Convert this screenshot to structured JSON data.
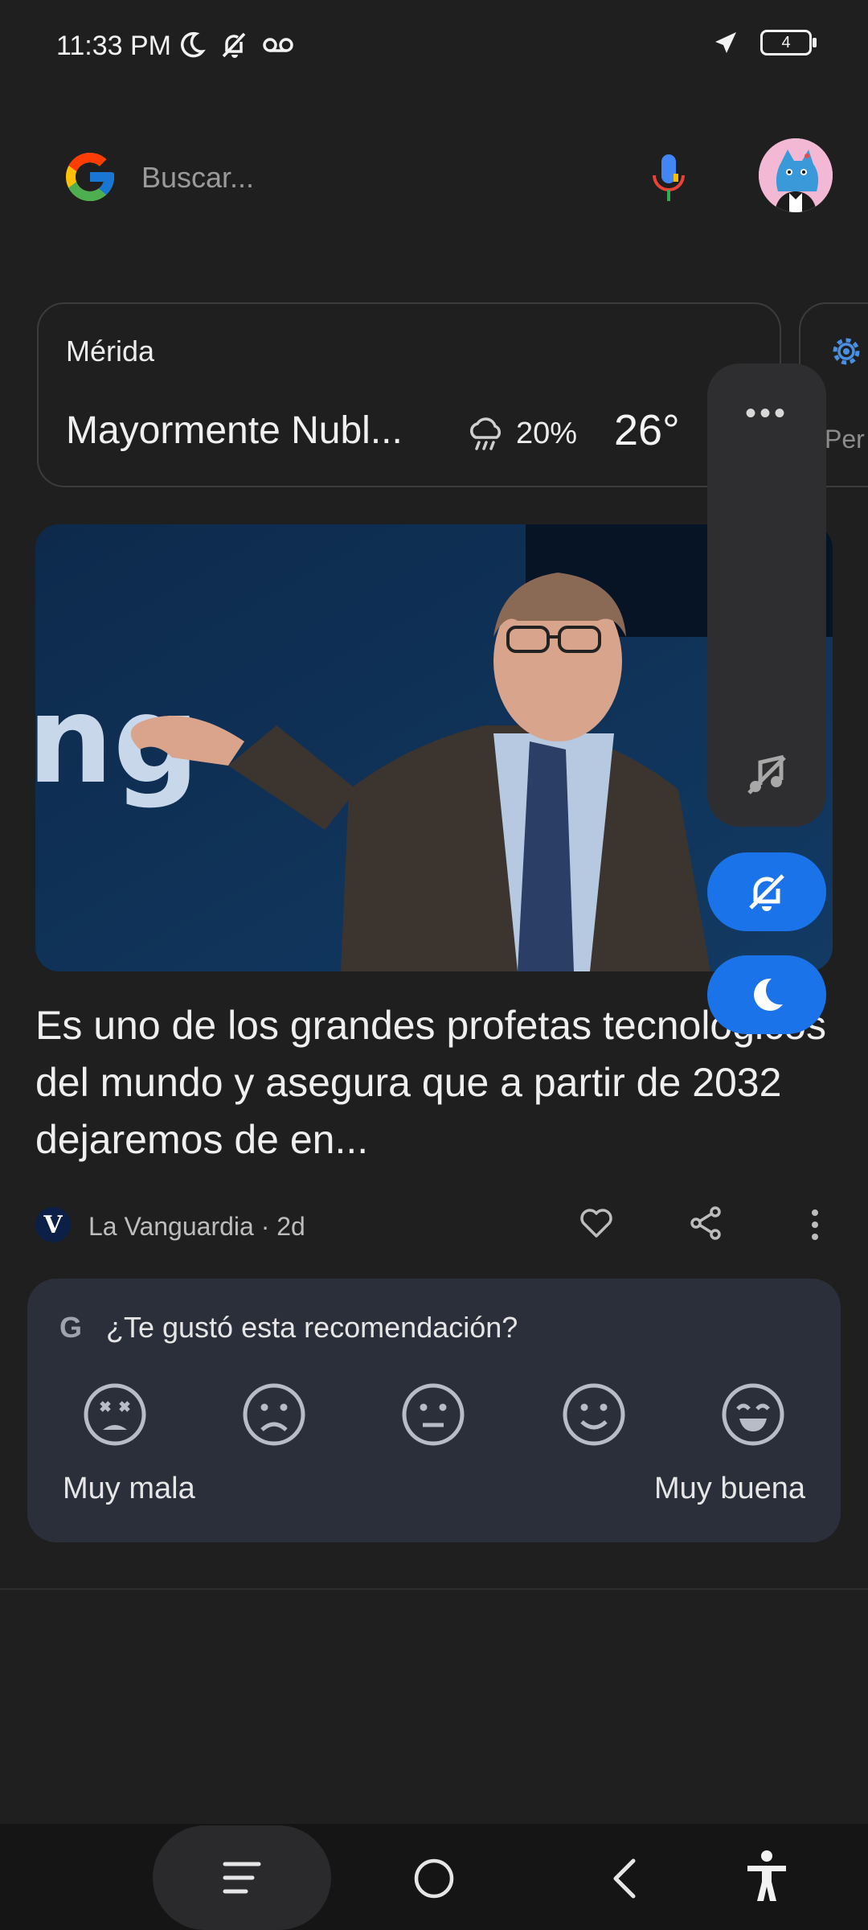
{
  "status_bar": {
    "time": "11:33 PM",
    "battery": "4",
    "icons": [
      "moon-icon",
      "bell-off-icon",
      "voicemail-icon",
      "airplane-icon",
      "battery-icon"
    ]
  },
  "search": {
    "placeholder": "Buscar..."
  },
  "weather": {
    "city": "Mérida",
    "condition": "Mayormente Nubl...",
    "rain_chance": "20%",
    "temperature": "26°"
  },
  "side_card": {
    "label": "Per"
  },
  "article": {
    "headline": "Es uno de los grandes profetas tecnológicos del mundo y asegura que a partir de 2032 dejaremos de en...",
    "source_initial": "V",
    "source": "La Vanguardia · 2d"
  },
  "feedback": {
    "g_mark": "G",
    "question": "¿Te gustó esta recomendación?",
    "low_label": "Muy mala",
    "high_label": "Muy buena",
    "faces": [
      "very-bad-face-icon",
      "bad-face-icon",
      "neutral-face-icon",
      "good-face-icon",
      "very-good-face-icon"
    ]
  },
  "volume_panel": {
    "menu": "•••"
  },
  "colors": {
    "accent": "#1a73e8",
    "background": "#1f1f20",
    "feedback_card": "#2b2f3a"
  }
}
